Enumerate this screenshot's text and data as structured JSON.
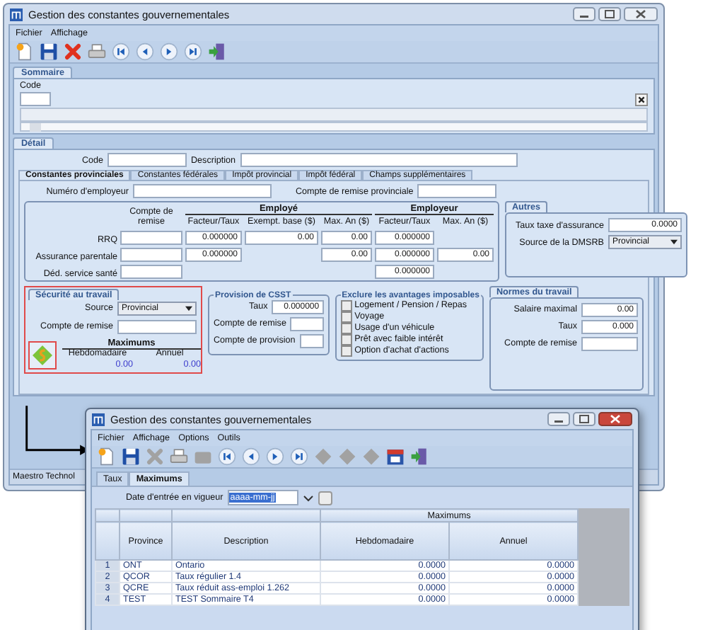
{
  "window": {
    "title": "Gestion des constantes gouvernementales"
  },
  "menu": [
    "Fichier",
    "Affichage"
  ],
  "toolbar": [
    {
      "kind": "new"
    },
    {
      "kind": "save"
    },
    {
      "kind": "delete"
    },
    {
      "kind": "print"
    },
    {
      "kind": "first"
    },
    {
      "kind": "prev"
    },
    {
      "kind": "next"
    },
    {
      "kind": "last"
    },
    {
      "kind": "exit"
    }
  ],
  "summary": {
    "tab": "Sommaire",
    "code_label": "Code"
  },
  "detail": {
    "tab": "Détail",
    "code_label": "Code",
    "description_label": "Description",
    "tabs": [
      {
        "label": "Constantes provinciales",
        "selected": true
      },
      {
        "label": "Constantes fédérales",
        "selected": false
      },
      {
        "label": "Impôt provincial",
        "selected": false
      },
      {
        "label": "Impôt fédéral",
        "selected": false
      },
      {
        "label": "Champs supplémentaires",
        "selected": false
      }
    ],
    "employer_number_label": "Numéro d'employeur",
    "remittance_account_label": "Compte de remise provinciale",
    "contributions": {
      "remittance_header": "Compte de remise",
      "employee_header": "Employé",
      "employer_header": "Employeur",
      "columns": [
        "Facteur/Taux",
        "Exempt. base ($)",
        "Max. An ($)",
        "Facteur/Taux",
        "Max. An ($)"
      ],
      "rows": [
        {
          "label": "RRQ",
          "cells": [
            "0.000000",
            "0.00",
            "0.00",
            "0.000000",
            null
          ]
        },
        {
          "label": "Assurance parentale",
          "cells": [
            "0.000000",
            null,
            "0.00",
            "0.000000",
            "0.00"
          ]
        },
        {
          "label": "Déd. service santé",
          "cells": [
            null,
            null,
            null,
            "0.000000",
            null
          ]
        }
      ]
    },
    "others": {
      "title": "Autres",
      "insurance_tax_label": "Taux taxe d'assurance",
      "insurance_tax": "0.0000",
      "dmsrb_label": "Source de la DMSRB",
      "dmsrb": "Provincial"
    }
  },
  "safety": {
    "tab": "Sécurité au travail",
    "source_label": "Source",
    "source": "Provincial",
    "remittance_label": "Compte de remise",
    "maximums_title": "Maximums",
    "weekly_label": "Hebdomadaire",
    "annual_label": "Annuel",
    "weekly": "0.00",
    "annual": "0.00"
  },
  "csst": {
    "title": "Provision de CSST",
    "rate_label": "Taux",
    "rate": "0.000000",
    "remittance_label": "Compte de remise",
    "provision_label": "Compte de provision"
  },
  "exclusions": {
    "title": "Exclure les avantages imposables",
    "items": [
      {
        "label": "Logement / Pension / Repas",
        "checked": false
      },
      {
        "label": "Voyage",
        "checked": false
      },
      {
        "label": "Usage d'un véhicule",
        "checked": false
      },
      {
        "label": "Prêt avec faible intérêt",
        "checked": false
      },
      {
        "label": "Option d'achat d'actions",
        "checked": false
      }
    ]
  },
  "labour": {
    "title": "Normes du travail",
    "max_salary_label": "Salaire maximal",
    "max_salary": "0.00",
    "rate_label": "Taux",
    "rate": "0.000",
    "remittance_label": "Compte de remise"
  },
  "status_bar": "Maestro Technol",
  "popup": {
    "title": "Gestion des constantes gouvernementales",
    "menu": [
      "Fichier",
      "Affichage",
      "Options",
      "Outils"
    ],
    "toolbar": [
      {
        "kind": "new",
        "disabled": false
      },
      {
        "kind": "save",
        "disabled": false
      },
      {
        "kind": "delete",
        "disabled": true
      },
      {
        "kind": "print",
        "disabled": false
      },
      {
        "kind": "briefcase",
        "disabled": true
      },
      {
        "kind": "first",
        "disabled": false
      },
      {
        "kind": "prev",
        "disabled": false
      },
      {
        "kind": "next",
        "disabled": false
      },
      {
        "kind": "last",
        "disabled": false
      },
      {
        "kind": "puzzle",
        "disabled": true
      },
      {
        "kind": "puzzle",
        "disabled": true
      },
      {
        "kind": "puzzle",
        "disabled": true
      },
      {
        "kind": "calendar",
        "disabled": false
      },
      {
        "kind": "exit",
        "disabled": false
      }
    ],
    "tabs": [
      {
        "label": "Taux",
        "selected": false
      },
      {
        "label": "Maximums",
        "selected": true
      }
    ],
    "date_label": "Date d'entrée en vigueur",
    "date_value": "aaaa-mm-jj",
    "group_header": "Maximums",
    "columns": [
      "Province",
      "Description",
      "Hebdomadaire",
      "Annuel"
    ],
    "rows": [
      {
        "number": "1",
        "province": "ONT",
        "description": "Ontario",
        "weekly": "0.0000",
        "annual": "0.0000"
      },
      {
        "number": "2",
        "province": "QCOR",
        "description": "Taux régulier 1.4",
        "weekly": "0.0000",
        "annual": "0.0000"
      },
      {
        "number": "3",
        "province": "QCRE",
        "description": "Taux réduit ass-emploi 1.262",
        "weekly": "0.0000",
        "annual": "0.0000"
      },
      {
        "number": "4",
        "province": "TEST",
        "description": "TEST Sommaire T4",
        "weekly": "0.0000",
        "annual": "0.0000"
      }
    ]
  }
}
